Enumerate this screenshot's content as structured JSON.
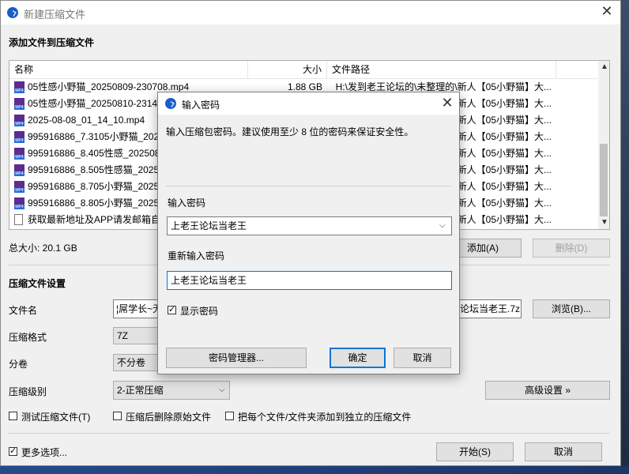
{
  "title": "新建压缩文件",
  "section_add": "添加文件到压缩文件",
  "columns": {
    "name": "名称",
    "size": "大小",
    "path": "文件路径"
  },
  "files": [
    {
      "icon": "video-file-icon",
      "name": "05性感小野猫_20250809-230708.mp4",
      "size": "1.88 GB",
      "path": "H:\\发到老王论坛的\\未整理的\\新人【05小野猫】大..."
    },
    {
      "icon": "video-file-icon",
      "name": "05性感小野猫_20250810-2314",
      "size": "",
      "path": "新人【05小野猫】大..."
    },
    {
      "icon": "video-file-icon",
      "name": "2025-08-08_01_14_10.mp4",
      "size": "",
      "path": "新人【05小野猫】大..."
    },
    {
      "icon": "video-file-icon",
      "name": "995916886_7.3105小野猫_202",
      "size": "",
      "path": "新人【05小野猫】大..."
    },
    {
      "icon": "video-file-icon",
      "name": "995916886_8.405性感_202508",
      "size": "",
      "path": "新人【05小野猫】大..."
    },
    {
      "icon": "video-file-icon",
      "name": "995916886_8.505性感猫_2025",
      "size": "",
      "path": "新人【05小野猫】大..."
    },
    {
      "icon": "video-file-icon",
      "name": "995916886_8.705小野猫_2025",
      "size": "",
      "path": "新人【05小野猫】大..."
    },
    {
      "icon": "video-file-icon",
      "name": "995916886_8.805小野猫_2025",
      "size": "",
      "path": "新人【05小野猫】大..."
    },
    {
      "icon": "text-file-icon",
      "name": "获取最新地址及APP请发邮箱自",
      "size": "",
      "path": "新人【05小野猫】大..."
    }
  ],
  "total_size": "总大小: 20.1 GB",
  "add_button": "添加(A)",
  "delete_button": "删除(D)",
  "section_settings": "压缩文件设置",
  "filename_label": "文件名",
  "filename_value_left": "¦屌学长~无",
  "filename_value_right": "论坛当老王.7z",
  "browse_button": "浏览(B)...",
  "format_label": "压缩格式",
  "format_value": "7Z",
  "split_label": "分卷",
  "split_value": "不分卷",
  "level_label": "压缩级别",
  "level_value": "2-正常压缩",
  "advanced_button": "高级设置 »",
  "opt_test": "测试压缩文件(T)",
  "opt_delete": "压缩后删除原始文件",
  "opt_each": "把每个文件/文件夹添加到独立的压缩文件",
  "more_options": "更多选项...",
  "start_button": "开始(S)",
  "cancel_button": "取消",
  "dialog": {
    "title": "输入密码",
    "desc": "输入压缩包密码。建议使用至少 8 位的密码来保证安全性。",
    "pwd_label": "输入密码",
    "pwd_value": "上老王论坛当老王",
    "repwd_label": "重新输入密码",
    "repwd_value": "上老王论坛当老王",
    "show_pwd": "显示密码",
    "manager_button": "密码管理器...",
    "ok_button": "确定",
    "cancel_button": "取消"
  },
  "colors": {
    "accent": "#0078d7",
    "app_icon": "#1a5fc9"
  }
}
